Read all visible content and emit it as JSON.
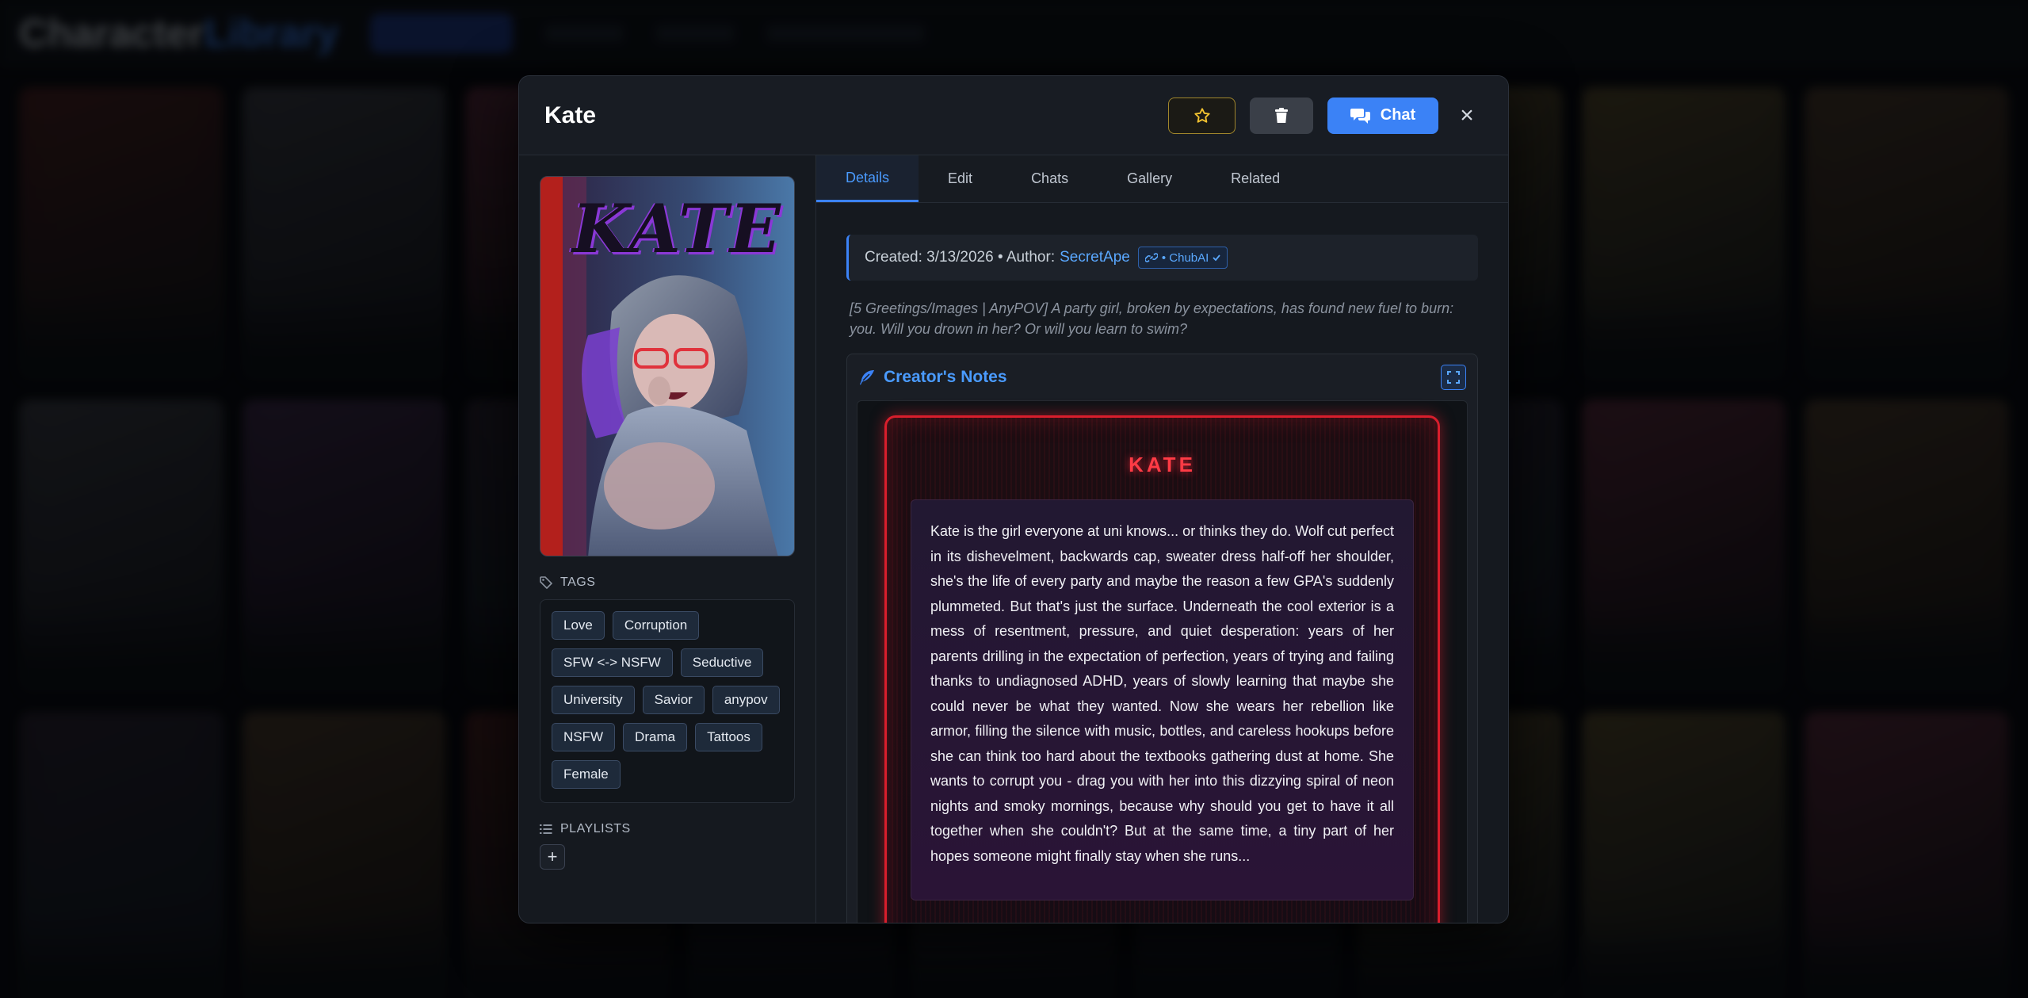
{
  "background": {
    "logo_first": "Character",
    "logo_second": "Library"
  },
  "modal": {
    "title": "Kate",
    "chat_label": "Chat",
    "close_glyph": "×"
  },
  "portrait": {
    "title": "KATE"
  },
  "tags_section": {
    "label": "TAGS",
    "items": [
      "Love",
      "Corruption",
      "SFW <-> NSFW",
      "Seductive",
      "University",
      "Savior",
      "anypov",
      "NSFW",
      "Drama",
      "Tattoos",
      "Female"
    ]
  },
  "playlists_section": {
    "label": "PLAYLISTS",
    "add_glyph": "+"
  },
  "tabs": [
    "Details",
    "Edit",
    "Chats",
    "Gallery",
    "Related"
  ],
  "details": {
    "meta_prefix": "Created: 3/13/2026 • Author:",
    "author": "SecretApe",
    "source_badge": "• ChubAI",
    "tagline": "[5 Greetings/Images | AnyPOV] A party girl, broken by expectations, has found new fuel to burn: you. Will you drown in her? Or will you learn to swim?",
    "notes_title": "Creator's Notes",
    "neon_title": "KATE",
    "story": "Kate is the girl everyone at uni knows... or thinks they do. Wolf cut perfect in its dishevelment, backwards cap, sweater dress half-off her shoulder, she's the life of every party and maybe the reason a few GPA's suddenly plummeted. But that's just the surface. Underneath the cool exterior is a mess of resentment, pressure, and quiet desperation: years of her parents drilling in the expectation of perfection, years of trying and failing thanks to undiagnosed ADHD, years of slowly learning that maybe she could never be what they wanted. Now she wears her rebellion like armor, filling the silence with music, bottles, and careless hookups before she can think too hard about the textbooks gathering dust at home. She wants to corrupt you - drag you with her into this dizzying spiral of neon nights and smoky mornings, because why should you get to have it all together when she couldn't? But at the same time, a tiny part of her hopes someone might finally stay when she runs..."
  },
  "icons": {
    "favorite": "star-outline-icon",
    "delete": "trash-icon",
    "chat": "chat-bubbles-icon",
    "tags": "tag-icon",
    "playlists": "list-icon",
    "notes": "feather-icon",
    "expand": "expand-icon",
    "source": "link-icon",
    "verified": "check-icon"
  },
  "colors": {
    "accent": "#3b82f6",
    "favorite": "#f4c430",
    "neon": "#d81e2c"
  }
}
